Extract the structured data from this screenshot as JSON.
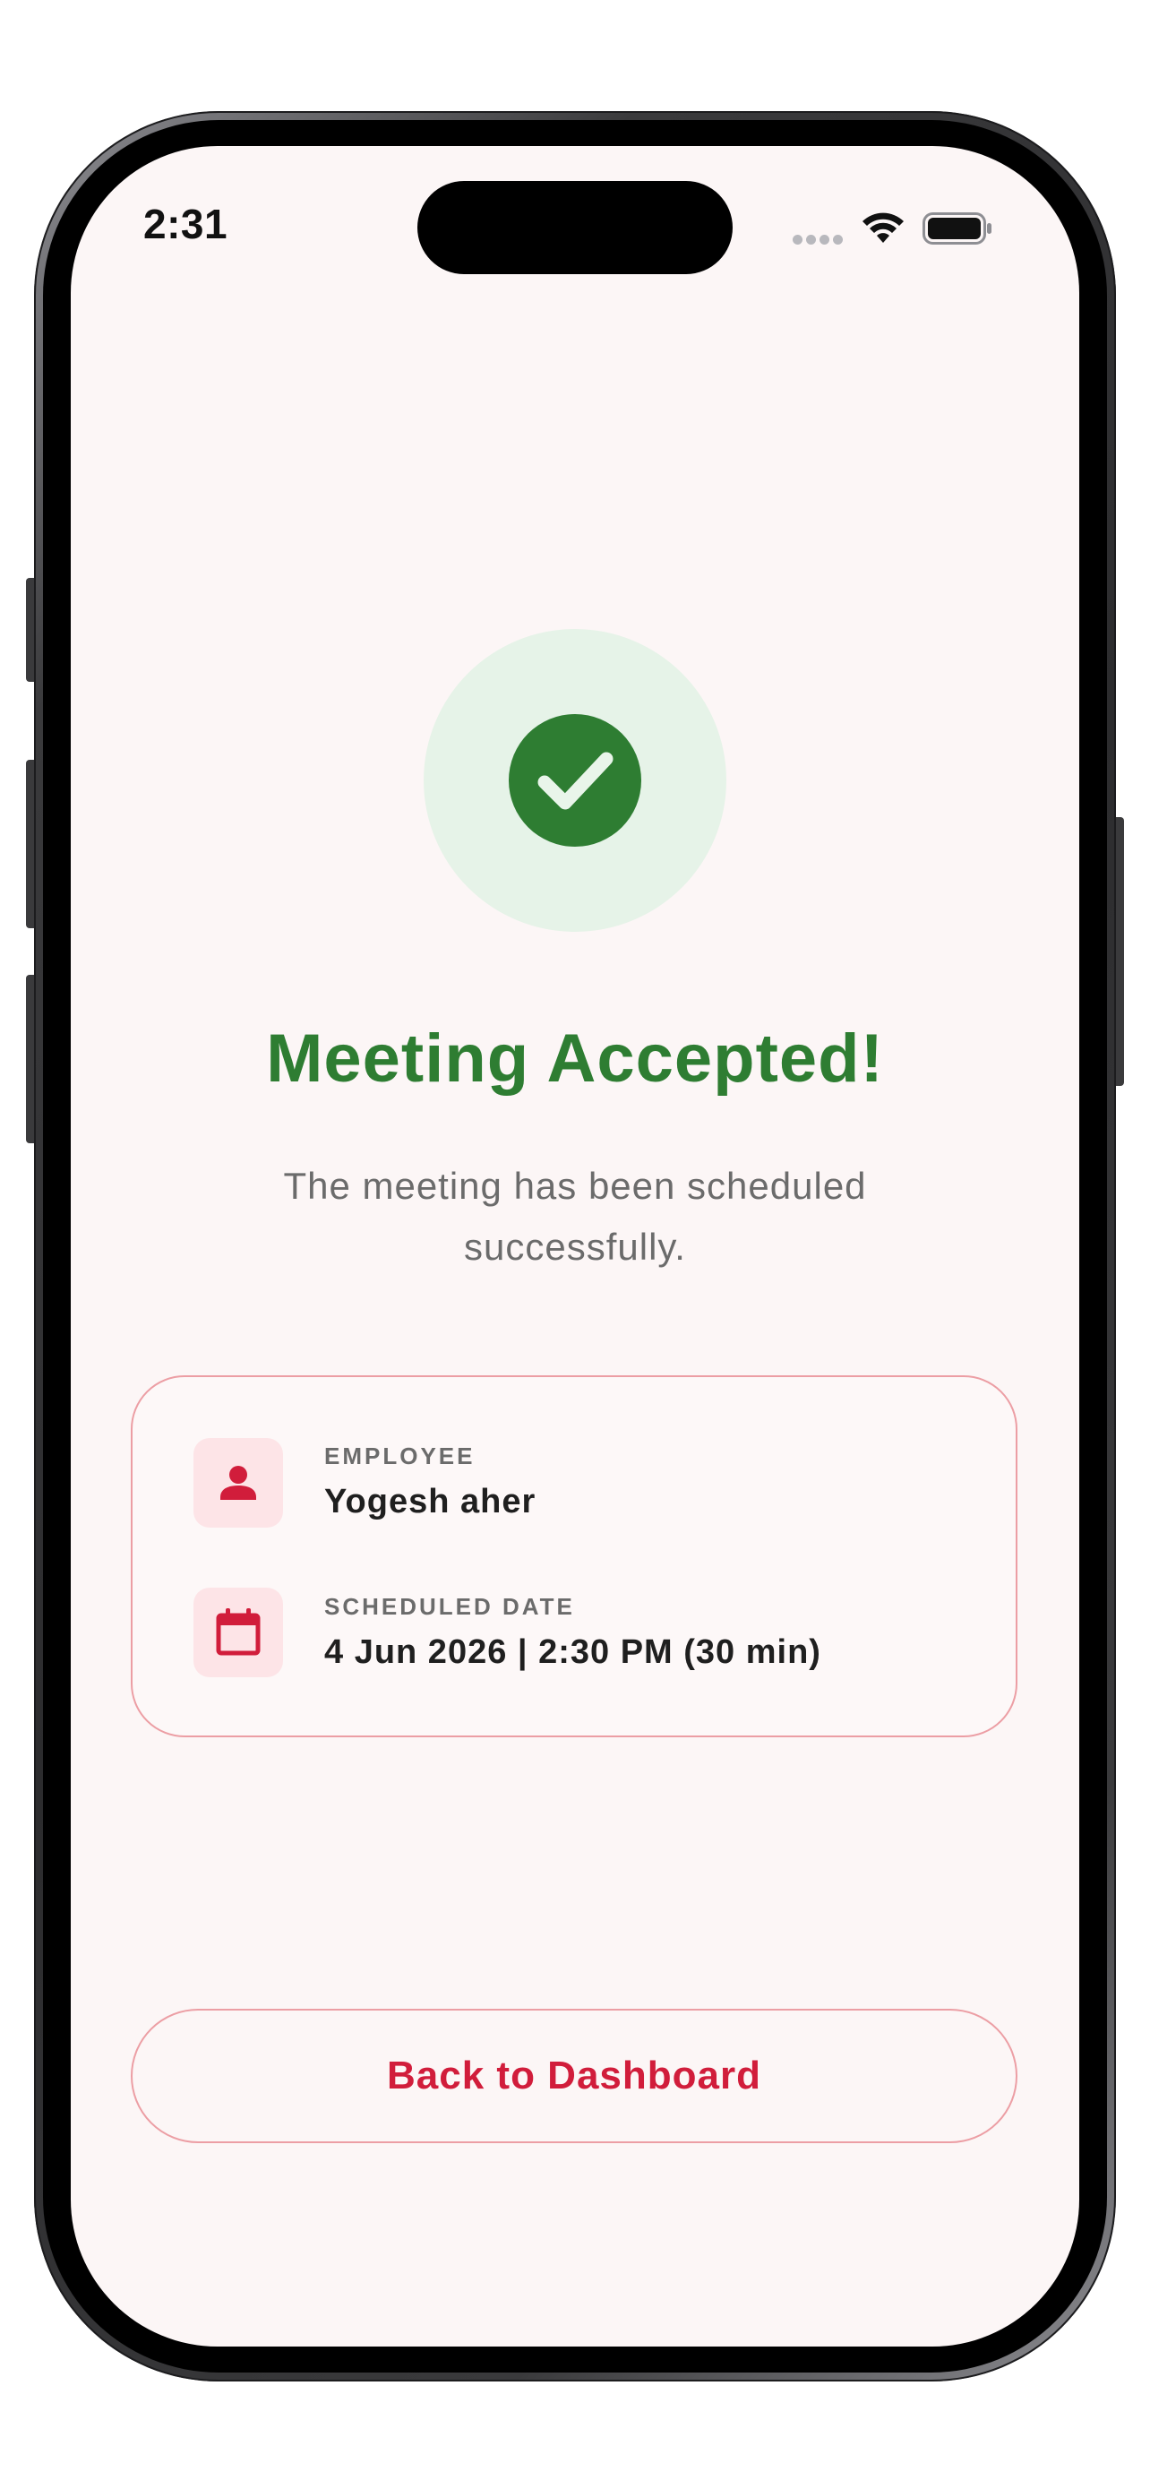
{
  "status_bar": {
    "time": "2:31"
  },
  "confirmation": {
    "icon": "check-circle-icon",
    "title": "Meeting Accepted!",
    "subtitle": "The meeting has been scheduled successfully."
  },
  "details": {
    "employee": {
      "icon": "person-icon",
      "label": "EMPLOYEE",
      "value": "Yogesh aher"
    },
    "scheduled_date": {
      "icon": "calendar-icon",
      "label": "SCHEDULED DATE",
      "value": "4 Jun 2026 | 2:30 PM (30 min)"
    }
  },
  "actions": {
    "back_label": "Back to Dashboard"
  },
  "colors": {
    "success": "#2e7d32",
    "success_bg": "#e6f3e8",
    "accent": "#d11d3b",
    "accent_border": "#ec9ea4",
    "screen_bg": "#fcf6f6"
  }
}
